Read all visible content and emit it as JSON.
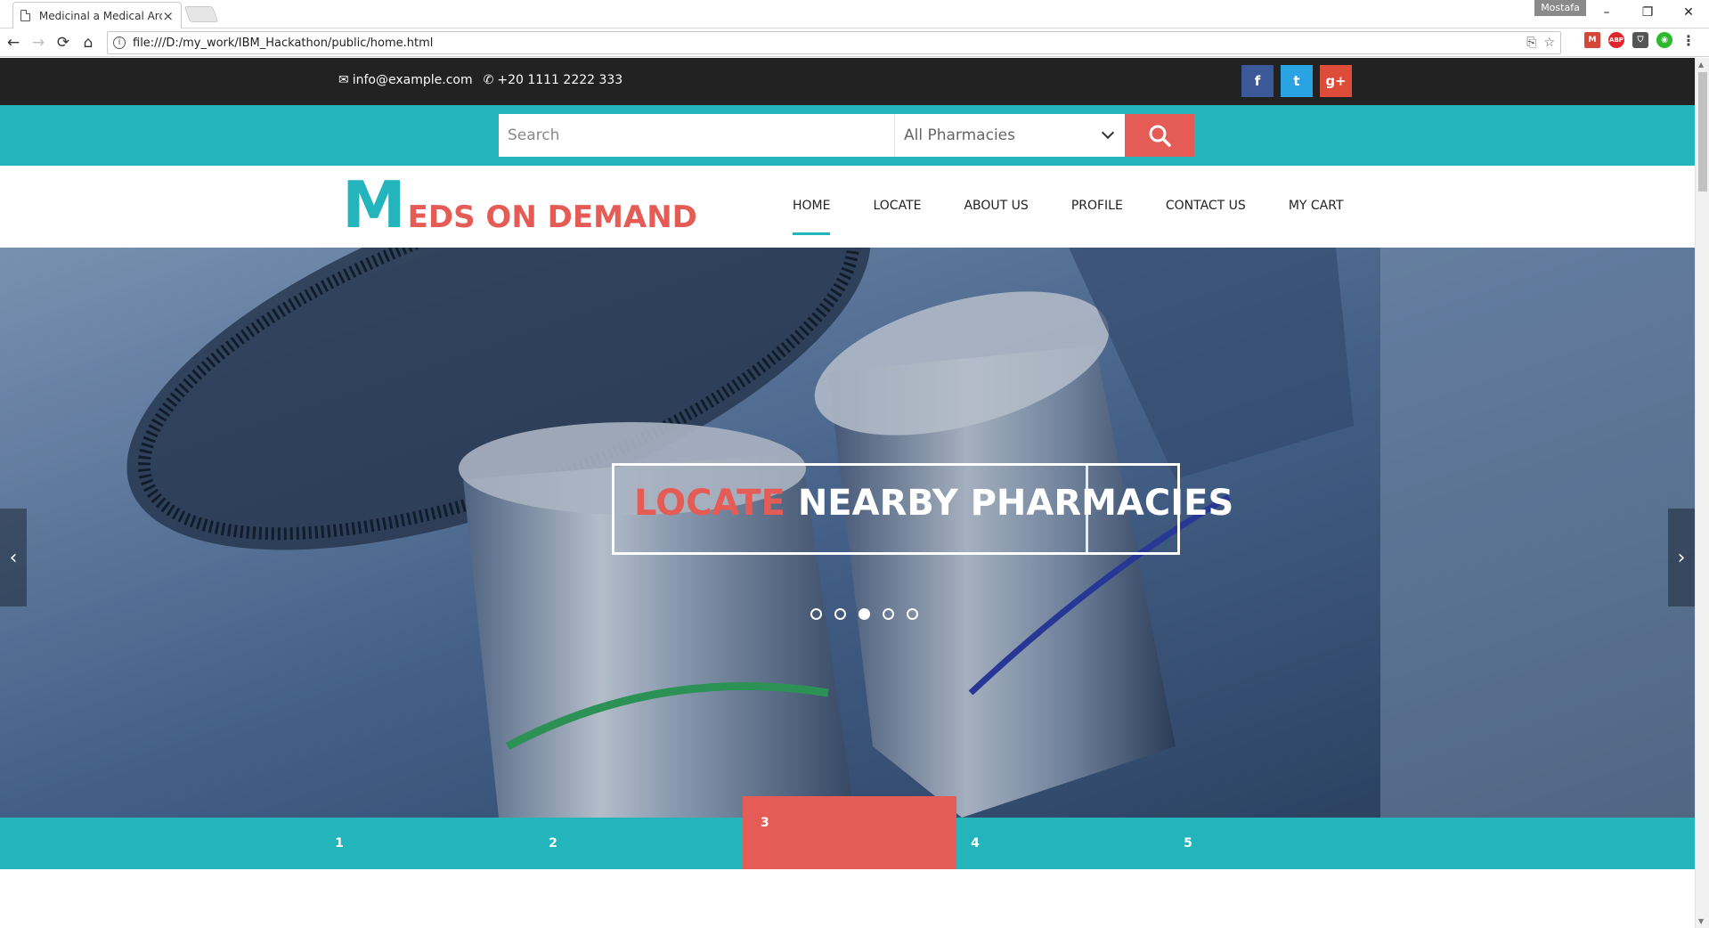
{
  "browser": {
    "tab_title": "Medicinal a Medical Arc",
    "tab_close": "×",
    "user": "Mostafa",
    "url": "file:///D:/my_work/IBM_Hackathon/public/home.html",
    "win_min": "–",
    "win_max": "❐",
    "win_close": "✕",
    "back": "←",
    "forward": "→",
    "reload": "⟳",
    "home": "⌂",
    "translate": "⎘",
    "star": "☆",
    "ext_gmail_badge": "M",
    "ext_abp": "ABP",
    "ext_pocket": "⛉",
    "ext_green": "◉",
    "menu": "⋮"
  },
  "topbar": {
    "email_icon": "✉",
    "email": "info@example.com",
    "phone_icon": "✆",
    "phone": "+20 1111 2222 333",
    "social": {
      "facebook": "f",
      "twitter": "t",
      "google": "g+"
    },
    "social_colors": {
      "facebook": "#3b5998",
      "twitter": "#2aa3e3",
      "google": "#dd4b39"
    }
  },
  "search": {
    "placeholder": "Search",
    "select_value": "All Pharmacies"
  },
  "logo": {
    "first_letter": "M",
    "rest": "EDS ON DEMAND"
  },
  "menu": {
    "home": "HOME",
    "locate": "LOCATE",
    "about": "ABOUT US",
    "profile": "PROFILE",
    "contact": "CONTACT US",
    "cart": "MY CART"
  },
  "hero": {
    "caption_highlight": "LOCATE",
    "caption_rest": "NEARBY PHARMACIES",
    "prev": "‹",
    "next": "›",
    "active_slide": 3
  },
  "thumbnails": [
    "1",
    "2",
    "3",
    "4",
    "5"
  ],
  "colors": {
    "teal": "#24b5bc",
    "red": "#e55b56",
    "dark": "#222222"
  }
}
